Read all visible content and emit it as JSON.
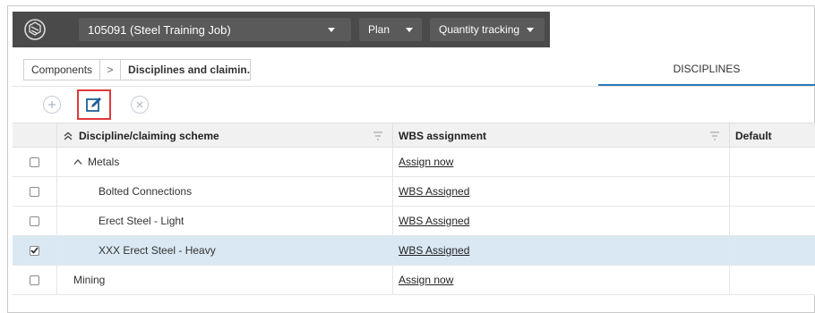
{
  "header": {
    "job_label": "105091 (Steel Training Job)",
    "plan_label": "Plan",
    "quantity_label": "Quantity tracking"
  },
  "breadcrumb": {
    "items": [
      "Components",
      "Disciplines and claimin..."
    ],
    "separator": ">"
  },
  "tabs": {
    "active": "DISCIPLINES"
  },
  "toolbar": {
    "add_icon": "plus-circle-icon",
    "edit_icon": "edit-pencil-icon",
    "remove_icon": "x-circle-icon"
  },
  "table": {
    "columns": [
      "Discipline/claiming scheme",
      "WBS assignment",
      "Default"
    ],
    "rows": [
      {
        "name": "Metals",
        "wbs": "Assign now",
        "default": "",
        "checked": false,
        "level": 0,
        "expanded": true
      },
      {
        "name": "Bolted Connections",
        "wbs": "WBS Assigned",
        "default": "",
        "checked": false,
        "level": 1
      },
      {
        "name": "Erect Steel - Light",
        "wbs": "WBS Assigned",
        "default": "",
        "checked": false,
        "level": 1
      },
      {
        "name": "XXX Erect Steel - Heavy",
        "wbs": "WBS Assigned",
        "default": "",
        "checked": true,
        "level": 1
      },
      {
        "name": "Mining",
        "wbs": "Assign now",
        "default": "",
        "checked": false,
        "level": 0
      }
    ]
  },
  "colors": {
    "topbar": "#4a4a4a",
    "accent": "#2a7ab8",
    "highlight_box": "#e03a3a",
    "selected_row": "#d9e8f3"
  }
}
